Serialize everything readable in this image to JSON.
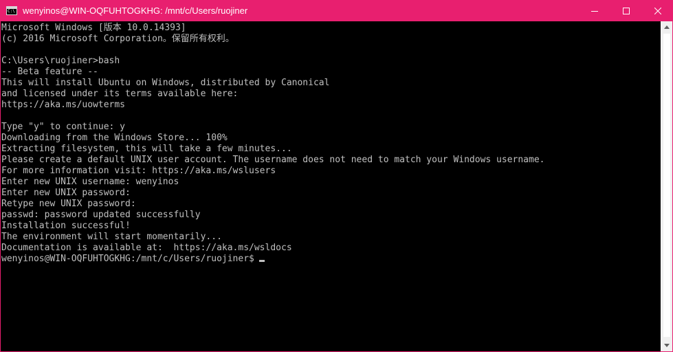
{
  "window": {
    "title": "wenyinos@WIN-OQFUHTOGKHG: /mnt/c/Users/ruojiner",
    "app_icon": "cmd-icon",
    "accent_color": "#e81f6f",
    "controls": {
      "minimize_icon": "minimize-icon",
      "maximize_icon": "maximize-icon",
      "close_icon": "close-icon"
    }
  },
  "console": {
    "text_color": "#c0c0c0",
    "background": "#000000",
    "lines": [
      "Microsoft Windows [版本 10.0.14393]",
      "(c) 2016 Microsoft Corporation。保留所有权利。",
      "",
      "C:\\Users\\ruojiner>bash",
      "-- Beta feature --",
      "This will install Ubuntu on Windows, distributed by Canonical",
      "and licensed under its terms available here:",
      "https://aka.ms/uowterms",
      "",
      "Type \"y\" to continue: y",
      "Downloading from the Windows Store... 100%",
      "Extracting filesystem, this will take a few minutes...",
      "Please create a default UNIX user account. The username does not need to match your Windows username.",
      "For more information visit: https://aka.ms/wslusers",
      "Enter new UNIX username: wenyinos",
      "Enter new UNIX password:",
      "Retype new UNIX password:",
      "passwd: password updated successfully",
      "Installation successful!",
      "The environment will start momentarily...",
      "Documentation is available at:  https://aka.ms/wsldocs"
    ],
    "prompt": "wenyinos@WIN-OQFUHTOGKHG:/mnt/c/Users/ruojiner$"
  },
  "scrollbar": {
    "up_icon": "scroll-up-arrow-icon",
    "down_icon": "scroll-down-arrow-icon"
  }
}
